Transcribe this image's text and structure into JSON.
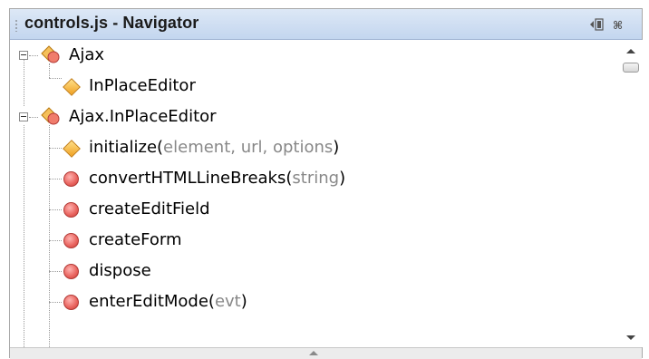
{
  "window": {
    "title": "controls.js - Navigator",
    "restore_icon": "restore-window-icon",
    "close_glyph": "⌘"
  },
  "tree": {
    "items": [
      {
        "label": "Ajax",
        "params": "",
        "icon": "class-icon"
      },
      {
        "label": "InPlaceEditor",
        "params": "",
        "icon": "field-diamond-icon"
      },
      {
        "label": "Ajax.InPlaceEditor",
        "params": "",
        "icon": "class-icon"
      },
      {
        "label": "initialize(",
        "params": "element, url, options",
        "close": ")",
        "icon": "field-diamond-icon"
      },
      {
        "label": "convertHTMLLineBreaks(",
        "params": "string",
        "close": ")",
        "icon": "method-icon"
      },
      {
        "label": "createEditField",
        "params": "",
        "icon": "method-icon"
      },
      {
        "label": "createForm",
        "params": "",
        "icon": "method-icon"
      },
      {
        "label": "dispose",
        "params": "",
        "icon": "method-icon"
      },
      {
        "label": "enterEditMode(",
        "params": "evt",
        "close": ")",
        "icon": "method-icon"
      }
    ]
  },
  "colors": {
    "titlebar": "#c9dbf2",
    "method_icon": "#e8625d",
    "field_icon": "#f0a020",
    "param_text": "#888888"
  }
}
